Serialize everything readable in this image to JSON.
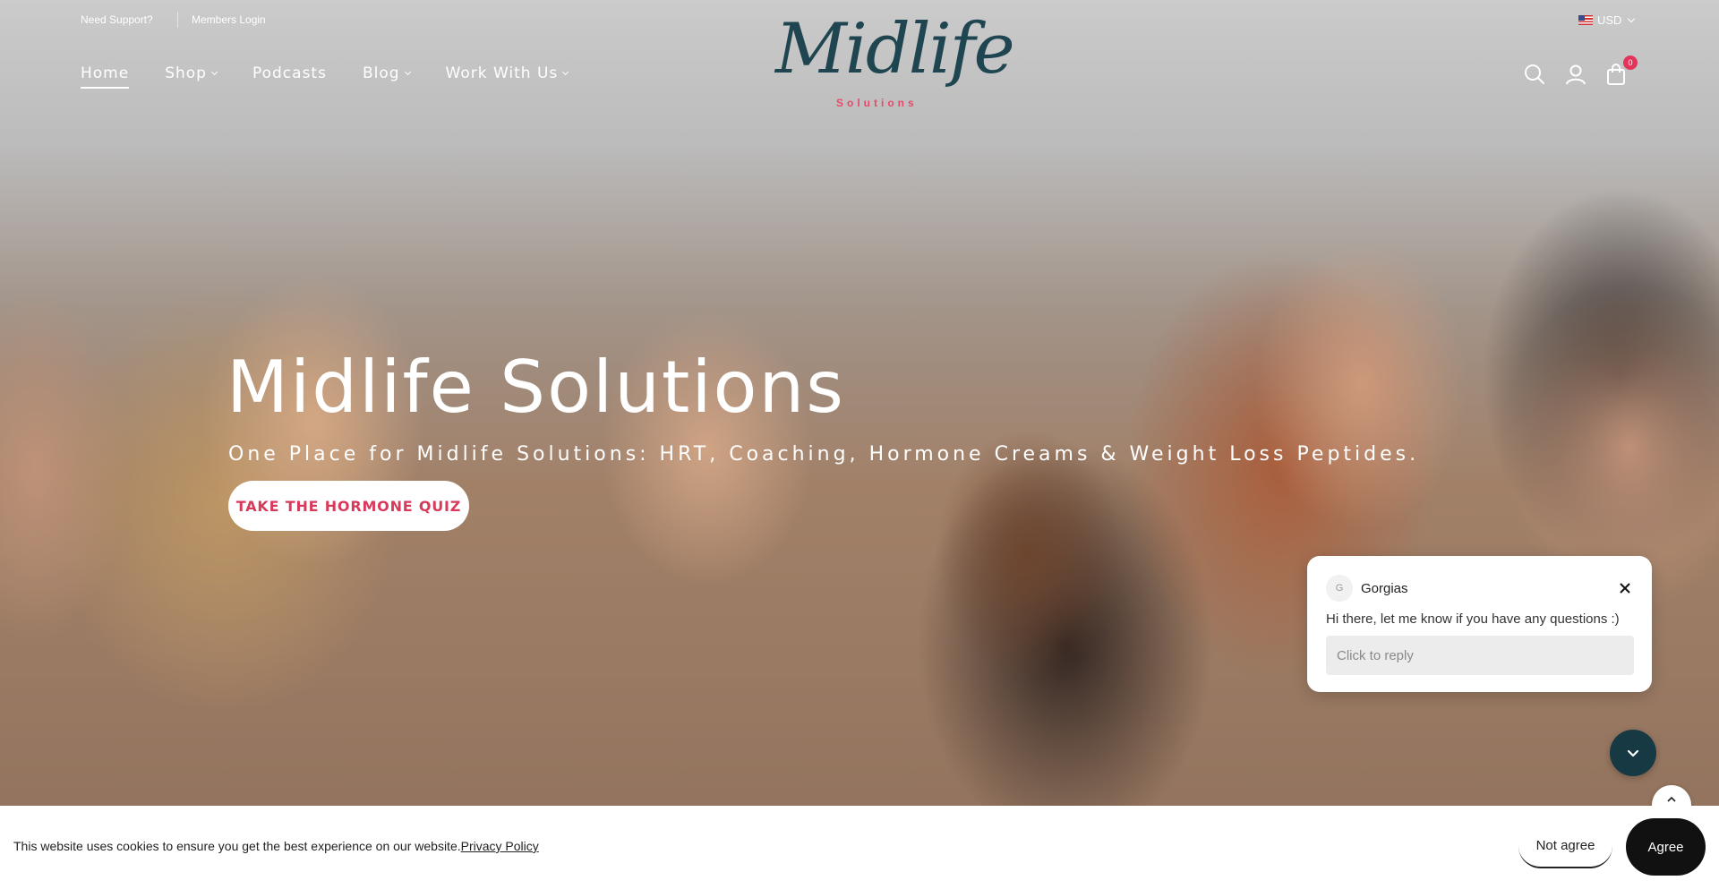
{
  "topbar": {
    "support_label": "Need Support?",
    "login_label": "Members Login",
    "currency_label": "USD",
    "currency_flag_icon": "us-flag-icon"
  },
  "nav": {
    "items": [
      {
        "label": "Home",
        "active": true,
        "dropdown": false
      },
      {
        "label": "Shop",
        "active": false,
        "dropdown": true
      },
      {
        "label": "Podcasts",
        "active": false,
        "dropdown": false
      },
      {
        "label": "Blog",
        "active": false,
        "dropdown": true
      },
      {
        "label": "Work With Us",
        "active": false,
        "dropdown": true
      }
    ]
  },
  "logo": {
    "script_text": "Midlife",
    "sub_text": "Solutions",
    "script_color": "#1f4550",
    "sub_color": "#e64a6a"
  },
  "header_icons": {
    "search_icon": "search-icon",
    "account_icon": "user-icon",
    "cart_icon": "shopping-bag-icon",
    "cart_count": "0"
  },
  "hero": {
    "title": "Midlife Solutions",
    "subtitle": "One Place for Midlife Solutions: HRT, Coaching, Hormone Creams & Weight Loss Peptides.",
    "cta_label": "TAKE THE HORMONE QUIZ",
    "cta_color": "#d83a5c"
  },
  "chat": {
    "avatar_letter": "G",
    "name": "Gorgias",
    "message": "Hi there, let me know if you have any questions :)",
    "reply_placeholder": "Click to reply",
    "toggle_color": "#163944"
  },
  "cookie": {
    "text": "This website uses cookies to ensure you get the best experience on our website.",
    "policy_link": "Privacy Policy",
    "not_agree_label": "Not agree",
    "agree_label": "Agree"
  }
}
